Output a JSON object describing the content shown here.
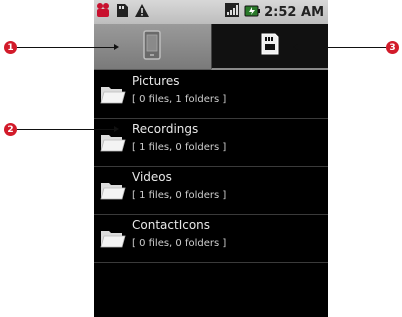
{
  "status_bar": {
    "time": "2:52 AM",
    "left_icons": [
      "notification-icon",
      "sd-card-icon",
      "warning-icon"
    ],
    "right_icons": [
      "signal-icon",
      "battery-icon"
    ]
  },
  "tabs": [
    {
      "name": "phone-tab",
      "icon": "phone-icon",
      "selected": true
    },
    {
      "name": "sd-card-tab",
      "icon": "sd-card-icon",
      "selected": false
    }
  ],
  "folders": [
    {
      "title": "Pictures",
      "info": "[ 0 files, 1 folders  ]"
    },
    {
      "title": "Recordings",
      "info": "[ 1 files, 0 folders  ]"
    },
    {
      "title": "Videos",
      "info": "[ 1 files, 0 folders  ]"
    },
    {
      "title": "ContactIcons",
      "info": "[ 0 files, 0 folders  ]"
    }
  ],
  "callouts": {
    "one": "1",
    "two": "2",
    "three": "3",
    "color": "#d21b2a"
  }
}
